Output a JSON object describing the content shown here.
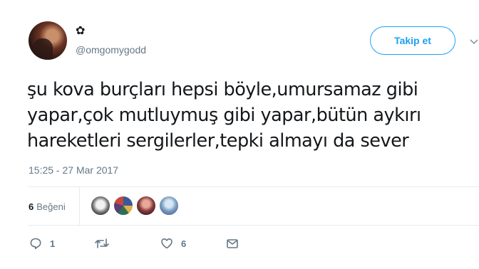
{
  "user": {
    "display_name": "✿",
    "handle": "@omgomygodd"
  },
  "follow_button": {
    "label": "Takip et"
  },
  "tweet": {
    "lines": [
      "şu kova burçları hepsi böyle,umursamaz gibi",
      "yapar,çok mutluymuş gibi yapar,bütün aykırı",
      "hareketleri sergilerler,tepki almayı da sever"
    ],
    "timestamp": "15:25 - 27 Mar 2017"
  },
  "stats": {
    "likes_count": "6",
    "likes_label": "Beğeni"
  },
  "actions": {
    "reply_count": "1",
    "like_count": "6"
  },
  "icons": {
    "reply": "reply-icon",
    "retweet": "retweet-icon",
    "like": "heart-icon",
    "message": "envelope-icon",
    "caret": "chevron-down-icon"
  },
  "colors": {
    "accent": "#1da1f2",
    "secondary_text": "#657786",
    "divider": "#e6ecf0"
  }
}
